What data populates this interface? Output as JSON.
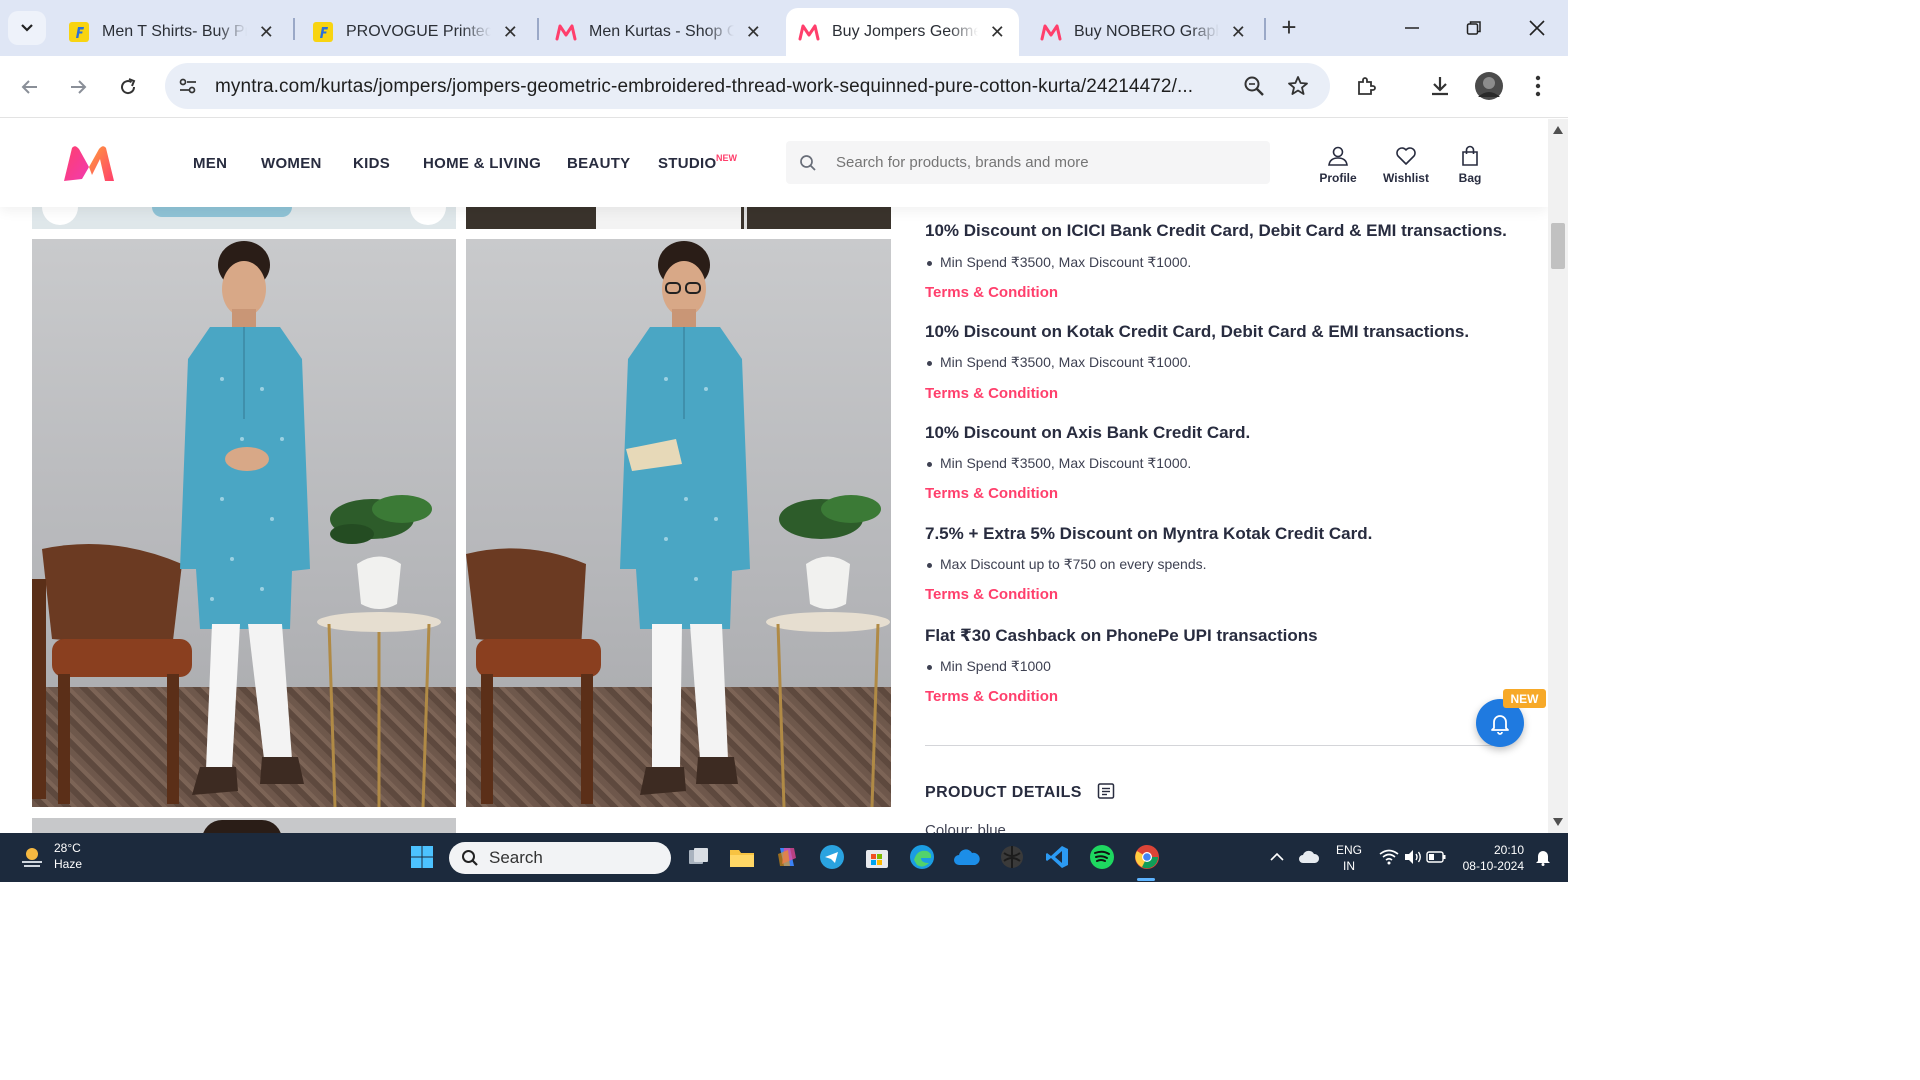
{
  "browser": {
    "tabs": [
      {
        "title": "Men T Shirts- Buy Products Online",
        "favicon": "flipkart-icon",
        "active": false
      },
      {
        "title": "PROVOGUE Printed Men Round Neck",
        "favicon": "flipkart-icon",
        "active": false
      },
      {
        "title": "Men Kurtas - Shop Online",
        "favicon": "myntra-icon",
        "active": false
      },
      {
        "title": "Buy Jompers Geometric Embroidered",
        "favicon": "myntra-icon",
        "active": true
      },
      {
        "title": "Buy NOBERO Graphic Printed",
        "favicon": "myntra-icon",
        "active": false
      }
    ],
    "url": "myntra.com/kurtas/jompers/jompers-geometric-embroidered-thread-work-sequinned-pure-cotton-kurta/24214472/..."
  },
  "site": {
    "nav": [
      "MEN",
      "WOMEN",
      "KIDS",
      "HOME & LIVING",
      "BEAUTY",
      "STUDIO"
    ],
    "studio_badge": "NEW",
    "search_placeholder": "Search for products, brands and more",
    "actions": {
      "profile": "Profile",
      "wishlist": "Wishlist",
      "bag": "Bag"
    }
  },
  "offers": [
    {
      "title": "10% Discount on ICICI Bank Credit Card, Debit Card & EMI transactions.",
      "bullet": "Min Spend ₹3500, Max Discount ₹1000.",
      "link": "Terms & Condition"
    },
    {
      "title": "10% Discount on Kotak Credit Card, Debit Card & EMI transactions.",
      "bullet": "Min Spend ₹3500, Max Discount ₹1000.",
      "link": "Terms & Condition"
    },
    {
      "title": "10% Discount on Axis Bank Credit Card.",
      "bullet": "Min Spend ₹3500, Max Discount ₹1000.",
      "link": "Terms & Condition"
    },
    {
      "title": "7.5% + Extra 5% Discount on Myntra Kotak Credit Card.",
      "bullet": "Max Discount up to ₹750 on every spends.",
      "link": "Terms & Condition"
    },
    {
      "title": "Flat ₹30 Cashback on PhonePe UPI transactions",
      "bullet": "Min Spend ₹1000",
      "link": "Terms & Condition"
    }
  ],
  "product_details": {
    "title": "PRODUCT DETAILS",
    "colour": "Colour: blue"
  },
  "notification_badge": "NEW",
  "taskbar": {
    "weather_temp": "28°C",
    "weather_desc": "Haze",
    "search_label": "Search",
    "lang_1": "ENG",
    "lang_2": "IN",
    "time": "20:10",
    "date": "08-10-2024"
  },
  "colors": {
    "brand_pink": "#ff3f6c",
    "kurta_blue": "#4aa6c4",
    "taskbar": "#1c2a3d"
  }
}
